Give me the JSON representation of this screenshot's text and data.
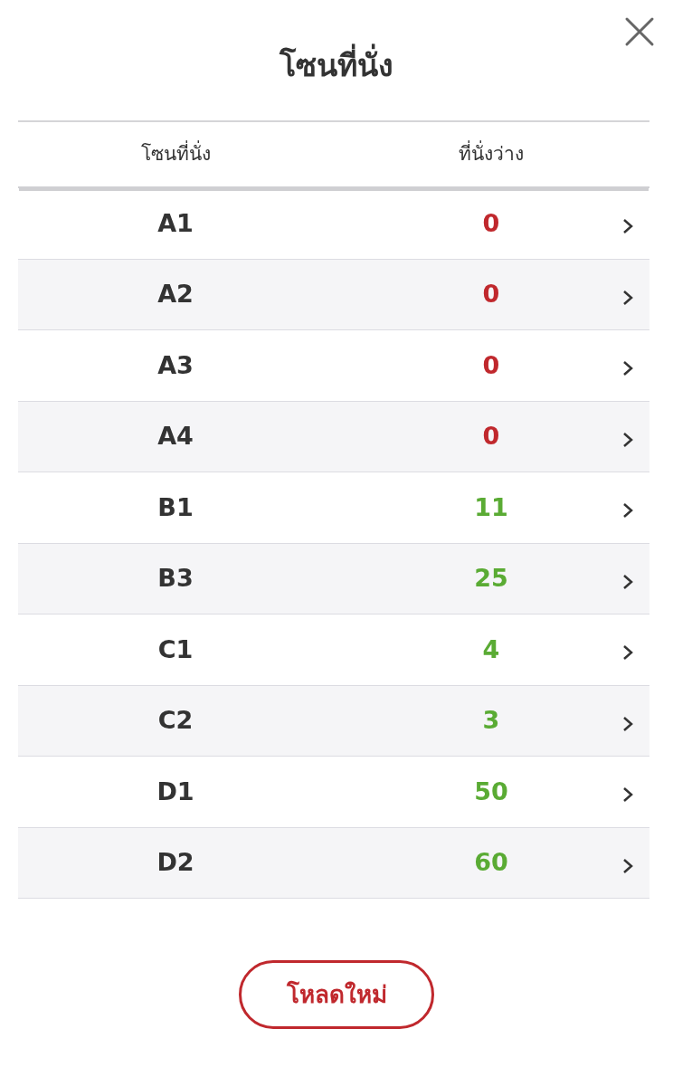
{
  "title": "โซนที่นั่ง",
  "columns": [
    "โซนที่นั่ง",
    "ที่นั่งว่าง"
  ],
  "rows": [
    {
      "zone": "A1",
      "available": "0",
      "color": "#c0282d"
    },
    {
      "zone": "A2",
      "available": "0",
      "color": "#c0282d"
    },
    {
      "zone": "A3",
      "available": "0",
      "color": "#c0282d"
    },
    {
      "zone": "A4",
      "available": "0",
      "color": "#c0282d"
    },
    {
      "zone": "B1",
      "available": "11",
      "color": "#5aab34"
    },
    {
      "zone": "B3",
      "available": "25",
      "color": "#5aab34"
    },
    {
      "zone": "C1",
      "available": "4",
      "color": "#5aab34"
    },
    {
      "zone": "C2",
      "available": "3",
      "color": "#5aab34"
    },
    {
      "zone": "D1",
      "available": "50",
      "color": "#5aab34"
    },
    {
      "zone": "D2",
      "available": "60",
      "color": "#5aab34"
    }
  ],
  "reload_button": "โหลดใหม่"
}
